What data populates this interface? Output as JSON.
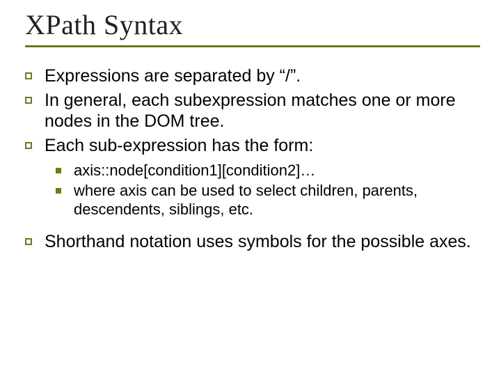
{
  "title": "XPath Syntax",
  "bullets1": {
    "a": "Expressions are separated by “/”.",
    "b": "In general, each subexpression matches one or more nodes in the DOM tree.",
    "c": "Each sub-expression has the form:"
  },
  "bullets2": {
    "a": "axis::node[condition1][condition2]…",
    "b": "where axis can be used to select children, parents, descendents, siblings, etc."
  },
  "bullets1b": {
    "d": "Shorthand notation uses symbols for the possible axes."
  }
}
